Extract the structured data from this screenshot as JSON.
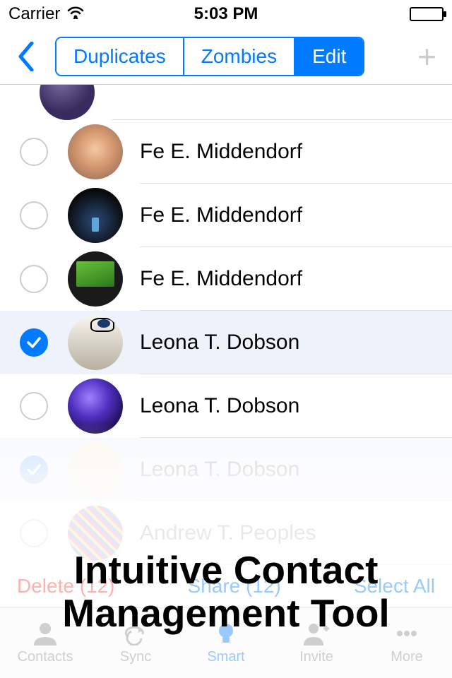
{
  "status": {
    "carrier": "Carrier",
    "time": "5:03 PM"
  },
  "nav": {
    "segments": [
      {
        "label": "Duplicates",
        "active": false
      },
      {
        "label": "Zombies",
        "active": false
      },
      {
        "label": "Edit",
        "active": true
      }
    ]
  },
  "contacts": [
    {
      "name": "",
      "checked": false,
      "faded": false
    },
    {
      "name": "Fe E. Middendorf",
      "checked": false,
      "faded": false
    },
    {
      "name": "Fe E. Middendorf",
      "checked": false,
      "faded": false
    },
    {
      "name": "Fe E. Middendorf",
      "checked": false,
      "faded": false
    },
    {
      "name": "Leona T. Dobson",
      "checked": true,
      "faded": false
    },
    {
      "name": "Leona T. Dobson",
      "checked": false,
      "faded": false
    },
    {
      "name": "Leona T. Dobson",
      "checked": true,
      "faded": true
    },
    {
      "name": "Andrew T. Peoples",
      "checked": false,
      "faded": true
    }
  ],
  "actions": {
    "delete": "Delete (12)",
    "share": "Share (12)",
    "select_all": "Select All"
  },
  "tabs": [
    {
      "label": "Contacts",
      "active": false
    },
    {
      "label": "Sync",
      "active": false
    },
    {
      "label": "Smart",
      "active": true
    },
    {
      "label": "Invite",
      "active": false
    },
    {
      "label": "More",
      "active": false
    }
  ],
  "overlay": {
    "line1": "Intuitive Contact",
    "line2": "Management Tool"
  }
}
